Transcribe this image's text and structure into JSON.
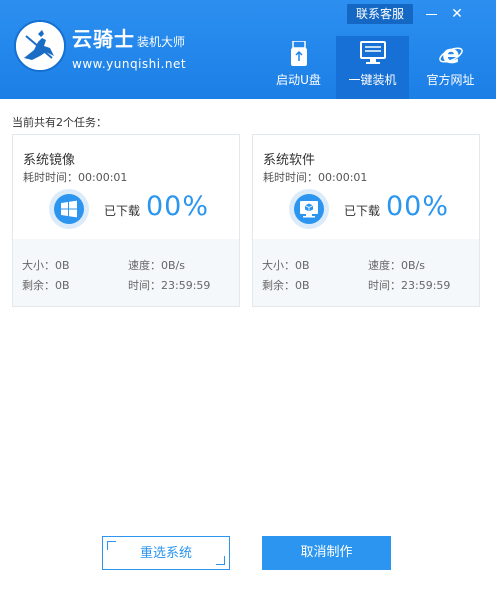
{
  "header": {
    "brand_name": "云骑士",
    "brand_suffix": "装机大师",
    "brand_url": "www.yunqishi.net",
    "support_label": "联系客服",
    "accent_color": "#2b95ef"
  },
  "nav": [
    {
      "label": "启动U盘",
      "icon": "usb-drive-icon"
    },
    {
      "label": "一键装机",
      "icon": "monitor-icon",
      "active": true
    },
    {
      "label": "官方网址",
      "icon": "ie-browser-icon"
    }
  ],
  "main": {
    "task_count": "当前共有2个任务：",
    "tasks": [
      {
        "name": "系统镜像",
        "elapsed": "耗时时间：00:00:01",
        "downloaded_label": "已下载",
        "percent": "00%",
        "icon": "windows-logo-icon",
        "size": "大小：0B",
        "remaining": "剩余：0B",
        "speed": "速度：0B/s",
        "time": "时间：23:59:59"
      },
      {
        "name": "系统软件",
        "elapsed": "耗时时间：00:00:01",
        "downloaded_label": "已下载",
        "percent": "00%",
        "icon": "software-monitor-icon",
        "size": "大小：0B",
        "remaining": "剩余：0B",
        "speed": "速度：0B/s",
        "time": "时间：23:59:59"
      }
    ]
  },
  "footer": {
    "reselect_label": "重选系统",
    "cancel_label": "取消制作"
  }
}
